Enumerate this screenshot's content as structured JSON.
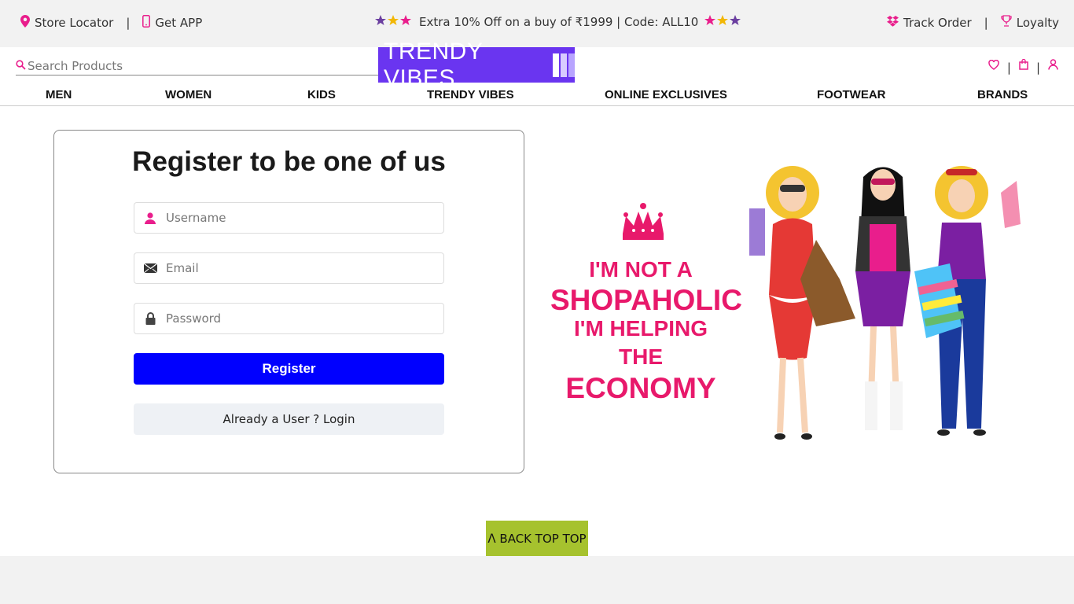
{
  "topbar": {
    "store_locator": "Store Locator",
    "get_app": "Get APP",
    "promo": "Extra 10% Off on a buy of ₹1999 | Code: ALL10",
    "track_order": "Track Order",
    "loyalty": "Loyalty",
    "separator": "|"
  },
  "header": {
    "search_placeholder": "Search Products",
    "logo_text": "TRENDY VIBES",
    "separator": "|"
  },
  "nav": {
    "items": [
      "MEN",
      "WOMEN",
      "KIDS",
      "TRENDY VIBES",
      "ONLINE EXCLUSIVES",
      "FOOTWEAR",
      "BRANDS"
    ]
  },
  "register": {
    "title": "Register to be one of us",
    "username_placeholder": "Username",
    "email_placeholder": "Email",
    "password_placeholder": "Password",
    "register_label": "Register",
    "login_label": "Already a User ? Login"
  },
  "promo_image": {
    "line1": "I'M NOT A",
    "line2": "SHOPAHOLIC",
    "line3": "I'M HELPING",
    "line4": "THE",
    "line5": "ECONOMY"
  },
  "back_to_top": "ᐱ BACK TOP TOP",
  "colors": {
    "accent_pink": "#e91e8c",
    "logo_purple": "#6a35f0",
    "register_blue": "#0000ff",
    "back_top_green": "#a6c22e"
  }
}
